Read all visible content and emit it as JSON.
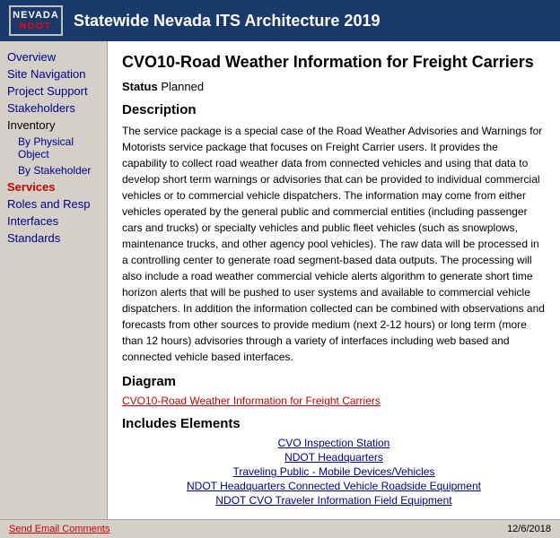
{
  "header": {
    "title": "Statewide Nevada ITS Architecture 2019",
    "logo_nevada": "NEVADA",
    "logo_ndot": "NDOT"
  },
  "sidebar": {
    "items": [
      {
        "label": "Overview",
        "active": false,
        "indent": false
      },
      {
        "label": "Site Navigation",
        "active": false,
        "indent": false
      },
      {
        "label": "Project Support",
        "active": false,
        "indent": false
      },
      {
        "label": "Stakeholders",
        "active": false,
        "indent": false
      },
      {
        "label": "Inventory",
        "active": false,
        "indent": false
      },
      {
        "label": "By Physical Object",
        "active": false,
        "indent": true
      },
      {
        "label": "By Stakeholder",
        "active": false,
        "indent": true
      },
      {
        "label": "Services",
        "active": true,
        "indent": false
      },
      {
        "label": "Roles and Resp",
        "active": false,
        "indent": false
      },
      {
        "label": "Interfaces",
        "active": false,
        "indent": false
      },
      {
        "label": "Standards",
        "active": false,
        "indent": false
      }
    ]
  },
  "content": {
    "title": "CVO10-Road Weather Information for Freight Carriers",
    "status_label": "Status",
    "status_value": "Planned",
    "description_heading": "Description",
    "description_text": "The service package is a special case of the Road Weather Advisories and Warnings for Motorists service package that focuses on Freight Carrier users. It provides the capability to collect road weather data from connected vehicles and using that data to develop short term warnings or advisories that can be provided to individual commercial vehicles or to commercial vehicle dispatchers. The information may come from either vehicles operated by the general public and commercial entities (including passenger cars and trucks) or specialty vehicles and public fleet vehicles (such as snowplows, maintenance trucks, and other agency pool vehicles). The raw data will be processed in a controlling center to generate road segment-based data outputs. The processing will also include a road weather commercial vehicle alerts algorithm to generate short time horizon alerts that will be pushed to user systems and available to commercial vehicle dispatchers. In addition the information collected can be combined with observations and forecasts from other sources to provide medium (next 2-12 hours) or long term (more than 12 hours) advisories through a variety of interfaces including web based and connected vehicle based interfaces.",
    "diagram_heading": "Diagram",
    "diagram_link": "CVO10-Road Weather Information for Freight Carriers",
    "elements_heading": "Includes Elements",
    "elements": [
      "CVO Inspection Station",
      "NDOT Headquarters",
      "Traveling Public - Mobile Devices/Vehicles",
      "NDOT Headquarters Connected Vehicle Roadside Equipment",
      "NDOT CVO Traveler Information Field Equipment"
    ]
  },
  "footer": {
    "email_link": "Send Email Comments",
    "date": "12/6/2018"
  }
}
